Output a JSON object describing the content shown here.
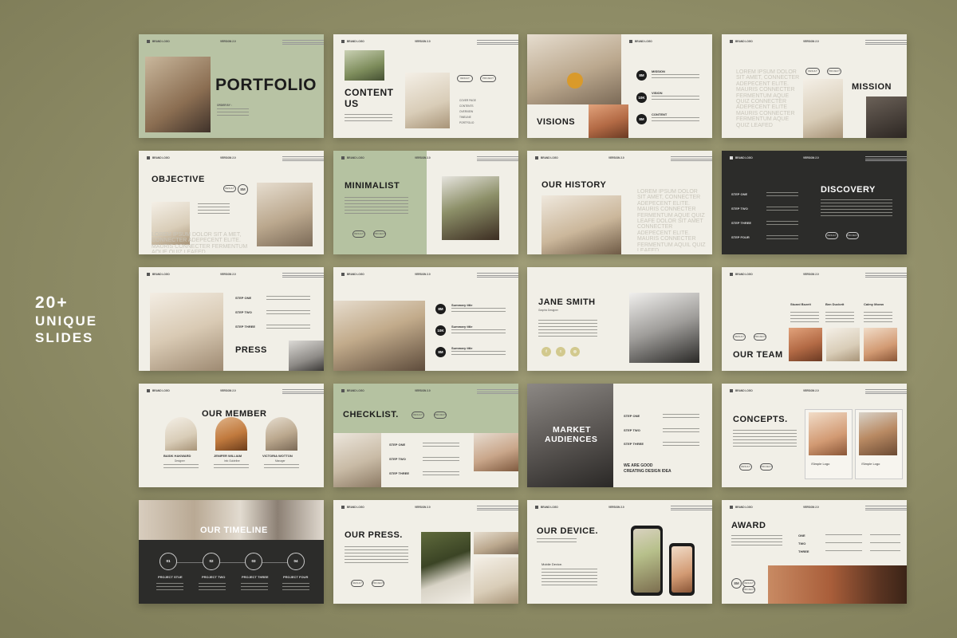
{
  "promo": {
    "line1": "20+",
    "line2": "UNIQUE",
    "line3": "SLIDES"
  },
  "brand_logo": "BRAND LOGO",
  "version": "VERSION 2.0",
  "slides": {
    "portfolio": {
      "title": "PORTFOLIO",
      "by": "ORDER BY :"
    },
    "content": {
      "title_line1": "CONTENT",
      "title_line2": "US",
      "items": [
        "COVER PAGE",
        "CONTENTS",
        "OVERVIEW",
        "TIMELINE",
        "PORTFOLIO"
      ]
    },
    "visions": {
      "title": "VISIONS",
      "items": [
        {
          "badge": "8M",
          "label": "MISSION"
        },
        {
          "badge": "10K",
          "label": "VISION"
        },
        {
          "badge": "8M",
          "label": "CONTENT"
        }
      ]
    },
    "mission": {
      "title": "MISSION",
      "lorem": "LOREM IPSUM DOLOR SIT AMET, CONNECTER ADEPECENT ELITE. MAURIS CONNECTER FERMENTUM AQUE QUIZ CONNECTER ADEPECENT ELITE MAURIS CONNECTER FERMENTUM AQUE QUIZ LEAFED"
    },
    "objective": {
      "title": "OBJECTIVE",
      "lorem": "LOREM IPSUM DOLOR SIT A MET, CONNECTER ADEPECENT ELITE. MAURIS CONNECTER FERMENTUM AQUE QUIZ LEAFED."
    },
    "minimalist": {
      "title": "MINIMALIST"
    },
    "history": {
      "title": "OUR HISTORY",
      "lorem": "LOREM IPSUM DOLOR SIT AMET, CONNECTER ADEPECENT ELITE. MAURIS CONNECTER FERMENTUM AQUE QUIZ LEAFE DOLOR SIT AMET CONNECTER ADEPECENT ELITE. MAURIS CONNECTER FERMENTUM AQUIL QUIZ LEAFED"
    },
    "discovery": {
      "title": "DISCOVERY",
      "steps": [
        "STEP ONE",
        "STEP TWO",
        "STEP THREE",
        "STEP FOUR"
      ]
    },
    "press": {
      "title": "PRESS",
      "steps": [
        "STEP ONE",
        "STEP TWO",
        "STEP THREE"
      ]
    },
    "summary": {
      "items": [
        {
          "badge": "8M",
          "label": "Summary title"
        },
        {
          "badge": "10K",
          "label": "Summary title"
        },
        {
          "badge": "8M",
          "label": "Summary title"
        }
      ]
    },
    "jane": {
      "title": "JANE SMITH",
      "role": "Graphic Designer"
    },
    "team": {
      "title": "OUR TEAM",
      "names": [
        "Stuard Bozeit",
        "Ben Duckett",
        "Calmy Moran"
      ]
    },
    "member": {
      "title": "OUR MEMBER",
      "people": [
        {
          "name": "BASIK HAKWARD",
          "role": "Designer"
        },
        {
          "name": "JENIFER WILLIAM",
          "role": "Info Guideline"
        },
        {
          "name": "VICTORIA WOTTON",
          "role": "Manager"
        }
      ]
    },
    "checklist": {
      "title": "CHECKLIST.",
      "steps": [
        "STEP ONE",
        "STEP TWO",
        "STEP THREE"
      ]
    },
    "market": {
      "title_line1": "MARKET",
      "title_line2": "AUDIENCES",
      "steps": [
        "STEP ONE",
        "STEP TWO",
        "STEP THREE"
      ],
      "tag_line1": "WE ARE GOOD",
      "tag_line2": "CREATING DESIGN IDEA"
    },
    "concepts": {
      "title": "CONCEPTS.",
      "labels": [
        "/Simple Logo",
        "/Simple Logo"
      ]
    },
    "timeline": {
      "title": "OUR TIMELINE",
      "nums": [
        "01",
        "02",
        "03",
        "04"
      ],
      "labels": [
        "PROJECT STUE",
        "PROJECT TWO",
        "PROJECT THREE",
        "PROJECT FOUR"
      ]
    },
    "ourpress": {
      "title": "OUR PRESS."
    },
    "device": {
      "title": "OUR DEVICE.",
      "sub": "Mobile Device."
    },
    "award": {
      "title": "AWARD",
      "rows": [
        "ONE",
        "TWO",
        "THREE"
      ]
    }
  },
  "pill_labels": {
    "left": "RESULT",
    "right": "PROJECT",
    "badge": "8M"
  }
}
